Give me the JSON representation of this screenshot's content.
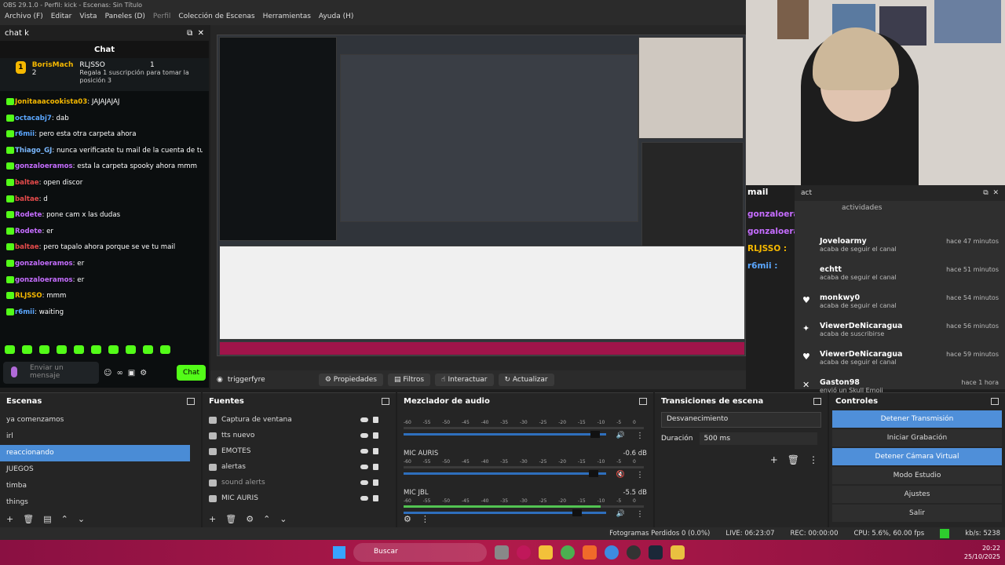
{
  "window": {
    "title": "OBS 29.1.0 - Perfil: kick - Escenas: Sin Título"
  },
  "menu": [
    "Archivo (F)",
    "Editar",
    "Vista",
    "Paneles (D)",
    "Perfil",
    "Colección de Escenas",
    "Herramientas",
    "Ayuda (H)"
  ],
  "chat": {
    "dock_title": "chat k",
    "header": "Chat",
    "pinned": {
      "user1": "BorisMach",
      "count1": "2",
      "user2": "RLJSSO",
      "count2": "1",
      "text": "Regala 1 suscripción para tomar la posición 3"
    },
    "messages": [
      {
        "user": "Jonitaaacookista03",
        "text": ": JAJAJAJAJ",
        "color": "#f5b800"
      },
      {
        "user": "octacabj7",
        "text": ": dab",
        "color": "#5ba7ff"
      },
      {
        "user": "r6mii",
        "text": ": pero esta otra carpeta ahora",
        "color": "#5ba7ff"
      },
      {
        "user": "Thiago_GJ",
        "text": ": nunca verificaste tu mail de la cuenta de tu ds",
        "color": "#7ab8ff"
      },
      {
        "user": "gonzaloeramos",
        "text": ": esta la carpeta spooky ahora mmm",
        "color": "#c56dff"
      },
      {
        "user": "baltae",
        "text": ": open discor",
        "color": "#e64b4b"
      },
      {
        "user": "baltae",
        "text": ": d",
        "color": "#e64b4b"
      },
      {
        "user": "Rodete",
        "text": ": pone cam x las dudas",
        "color": "#c56dff"
      },
      {
        "user": "Rodete",
        "text": ": er",
        "color": "#c56dff"
      },
      {
        "user": "baltae",
        "text": ": pero tapalo ahora porque se ve tu mail",
        "color": "#e64b4b"
      },
      {
        "user": "gonzaloeramos",
        "text": ": er",
        "color": "#c56dff"
      },
      {
        "user": "gonzaloeramos",
        "text": ": er",
        "color": "#c56dff"
      },
      {
        "user": "RLJSSO",
        "text": ": mmm",
        "color": "#f5b800"
      },
      {
        "user": "r6mii",
        "text": ": waiting",
        "color": "#5ba7ff"
      }
    ],
    "input_placeholder": "Enviar un mensaje",
    "send_label": "Chat"
  },
  "preview_toolbar": {
    "source": "triggerfyre",
    "props": "Propiedades",
    "filters": "Filtros",
    "interact": "Interactuar",
    "refresh": "Actualizar"
  },
  "mail": {
    "title": "mail",
    "names": [
      {
        "name": "gonzaloeramos :",
        "color": "#c56dff"
      },
      {
        "name": "gonzaloeramos :",
        "color": "#c56dff"
      },
      {
        "name": "RLJSSO :",
        "color": "#f5b800"
      },
      {
        "name": "r6mii :",
        "color": "#5ba7ff"
      }
    ]
  },
  "activity": {
    "title": "act",
    "subtitle": "actividades",
    "items": [
      {
        "icon": "",
        "name": "Joveloarmy",
        "sub": "acaba de seguir el canal",
        "time": "hace 47 minutos"
      },
      {
        "icon": "",
        "name": "echtt",
        "sub": "acaba de seguir el canal",
        "time": "hace 51 minutos"
      },
      {
        "icon": "♥",
        "name": "monkwy0",
        "sub": "acaba de seguir el canal",
        "time": "hace 54 minutos"
      },
      {
        "icon": "✦",
        "name": "ViewerDeNicaragua",
        "sub": "acaba de suscribirse",
        "time": "hace 56 minutos"
      },
      {
        "icon": "♥",
        "name": "ViewerDeNicaragua",
        "sub": "acaba de seguir el canal",
        "time": "hace 59 minutos"
      },
      {
        "icon": "✕",
        "name": "Gaston98",
        "sub": "envió un Skull Emoji",
        "time": "hace 1 hora"
      }
    ]
  },
  "scenes": {
    "title": "Escenas",
    "items": [
      "ya comenzamos",
      "irl",
      "reaccionando",
      "JUEGOS",
      "timba",
      "things"
    ],
    "selected": 2
  },
  "sources": {
    "title": "Fuentes",
    "items": [
      "Captura de ventana",
      "tts nuevo",
      "EMOTES",
      "alertas",
      "sound alerts",
      "MIC AURIS"
    ]
  },
  "mixer": {
    "title": "Mezclador de audio",
    "scale": [
      "-60",
      "-55",
      "-50",
      "-45",
      "-40",
      "-35",
      "-30",
      "-25",
      "-20",
      "-15",
      "-10",
      "-5",
      "0"
    ],
    "channels": [
      {
        "name": "",
        "db": "",
        "muted": false,
        "level": 0.0,
        "fader": 0.97
      },
      {
        "name": "MIC AURIS",
        "db": "-0.6 dB",
        "muted": true,
        "level": 0.0,
        "fader": 0.96
      },
      {
        "name": "MIC JBL",
        "db": "-5.5 dB",
        "muted": false,
        "level": 0.82,
        "fader": 0.88
      }
    ]
  },
  "transitions": {
    "title": "Transiciones de escena",
    "current": "Desvanecimiento",
    "duration_label": "Duración",
    "duration": "500 ms"
  },
  "controls": {
    "title": "Controles",
    "buttons": [
      {
        "label": "Detener Transmisión",
        "active": true
      },
      {
        "label": "Iniciar Grabación",
        "active": false
      },
      {
        "label": "Detener Cámara Virtual",
        "active": true
      },
      {
        "label": "Modo Estudio",
        "active": false
      },
      {
        "label": "Ajustes",
        "active": false
      },
      {
        "label": "Salir",
        "active": false
      }
    ]
  },
  "status": {
    "dropped": "Fotogramas Perdidos 0 (0.0%)",
    "live": "LIVE: 06:23:07",
    "rec": "REC: 00:00:00",
    "cpu": "CPU: 5.6%, 60.00 fps",
    "kbs": "kb/s: 5238"
  },
  "taskbar": {
    "search": "Buscar",
    "time": "20:22",
    "date": "25/10/2025"
  }
}
